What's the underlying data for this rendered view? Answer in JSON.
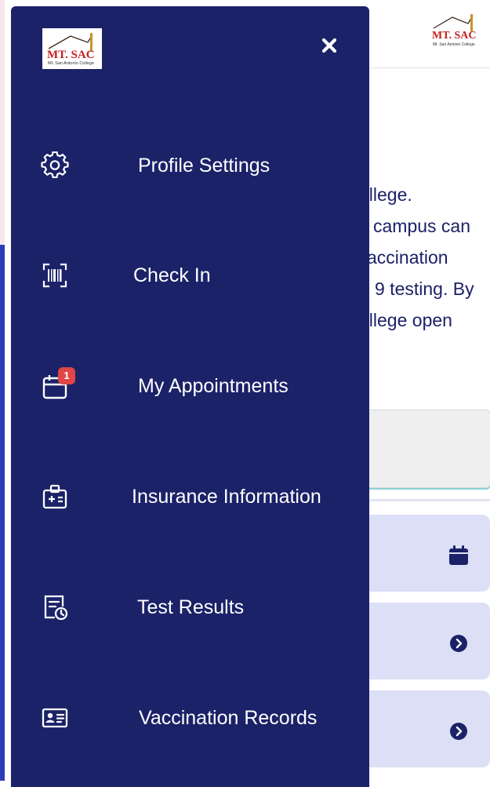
{
  "app": {
    "logo_text": "MT. SAC",
    "logo_subtext": "Mt. San Antonio College"
  },
  "background_page": {
    "text_lines": [
      "ollege.",
      "campus can",
      "accination",
      "9 testing. By",
      "ollege open"
    ]
  },
  "drawer": {
    "close_icon": "close-x-icon",
    "items": [
      {
        "label": "Profile Settings",
        "icon": "gear-icon"
      },
      {
        "label": "Check In",
        "icon": "barcode-scan-icon"
      },
      {
        "label": "My Appointments",
        "icon": "calendar-icon",
        "badge": "1"
      },
      {
        "label": "Insurance Information",
        "icon": "medical-id-icon"
      },
      {
        "label": "Test Results",
        "icon": "results-clock-icon"
      },
      {
        "label": "Vaccination Records",
        "icon": "id-card-icon"
      }
    ]
  },
  "colors": {
    "drawer_bg": "#1b2268",
    "text_primary": "#1c2167",
    "badge": "#e04646",
    "card_bg": "#dcdff5"
  }
}
